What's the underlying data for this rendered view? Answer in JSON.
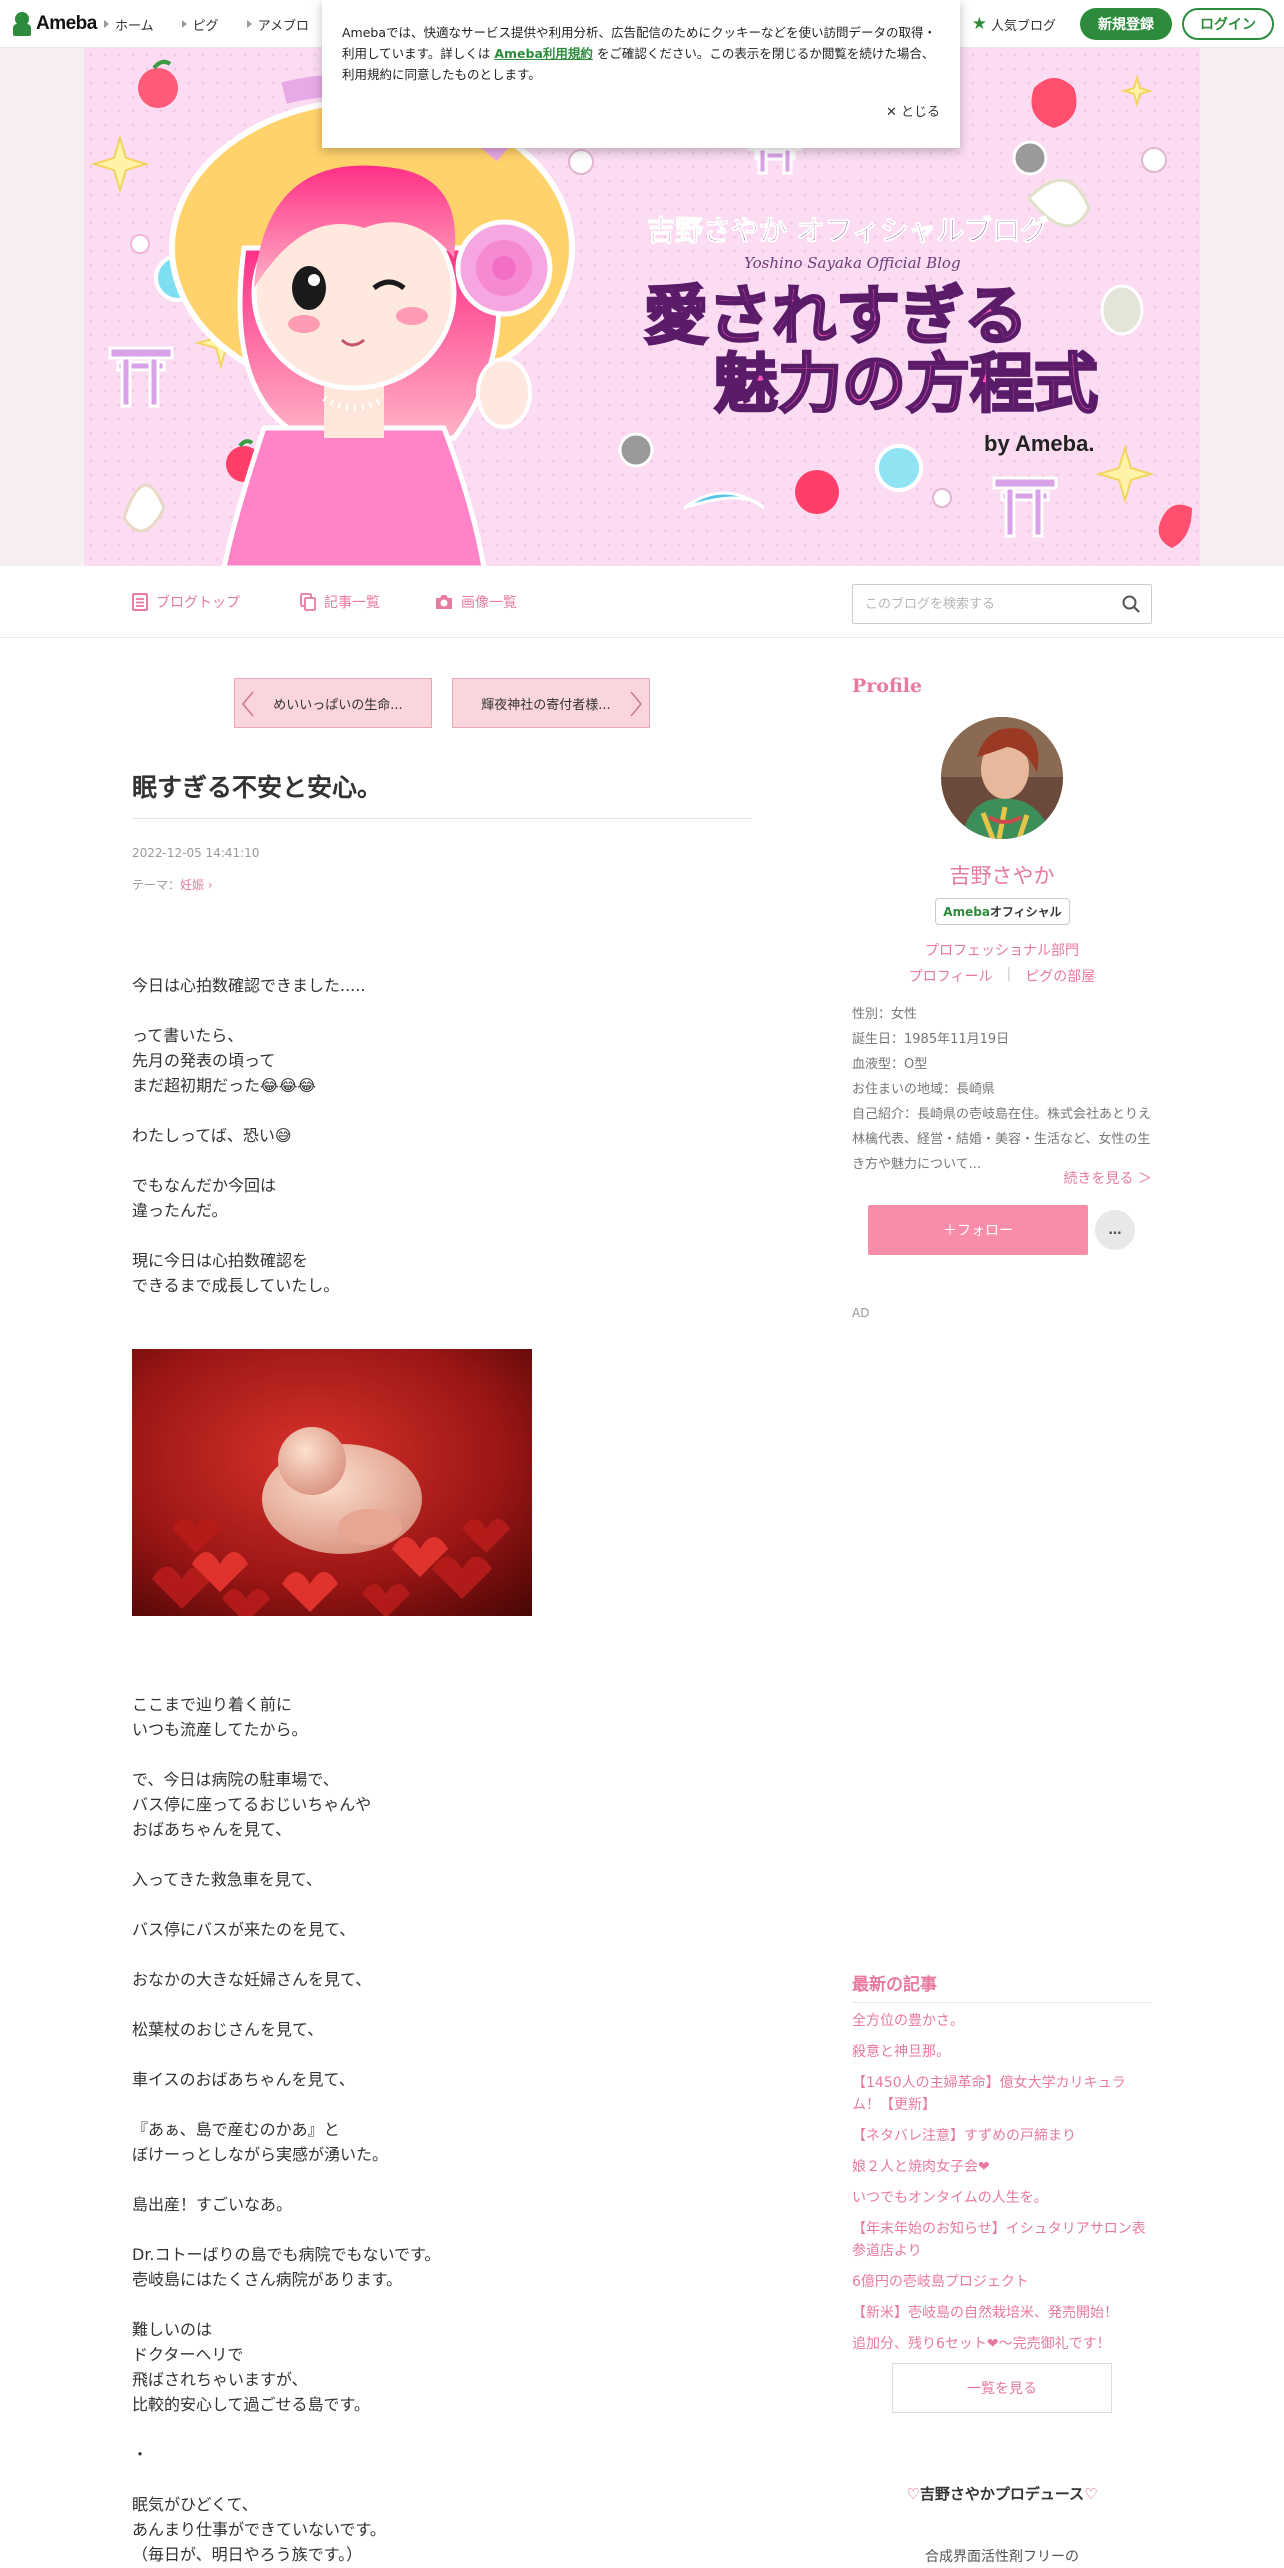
{
  "global_header": {
    "logo_text": "Ameba",
    "nav": [
      "ホーム",
      "ピグ",
      "アメブロ"
    ],
    "popular_blog": "人気ブログ",
    "register": "新規登録",
    "login": "ログイン"
  },
  "cookie_notice": {
    "text_before": "Amebaでは、快適なサービス提供や利用分析、広告配信のためにクッキーなどを使い訪問データの取得・利用しています。詳しくは ",
    "link_text": "Ameba利用規約",
    "text_after": " をご確認ください。この表示を閉じるか閲覧を続けた場合、利用規約に同意したものとします。",
    "close": "✕ とじる"
  },
  "banner": {
    "title_small": "吉野さやか オフィシャルブログ",
    "title_roman": "Yoshino Sayaka Official Blog",
    "title_main_1": "愛されすぎる",
    "title_main_2": "魅力の方程式",
    "by_label": "by Ameba."
  },
  "blog_nav": {
    "top": "ブログトップ",
    "list": "記事一覧",
    "images": "画像一覧",
    "search_placeholder": "このブログを検索する"
  },
  "article": {
    "prev": "めいいっぱいの生命...",
    "next": "輝夜神社の寄付者様...",
    "title": "眠すぎる不安と安心。",
    "date": "2022-12-05 14:41:10",
    "theme_label": "テーマ：",
    "theme_value": "妊娠",
    "paragraphs_a": [
      "今日は心拍数確認できました.....",
      "",
      "って書いたら、",
      "先月の発表の頃って",
      "まだ超初期だった😂😂😂",
      "",
      "わたしってば、恐い😅",
      "",
      "でもなんだか今回は",
      "違ったんだ。",
      "",
      "現に今日は心拍数確認を",
      "できるまで成長していたし。"
    ],
    "paragraphs_b": [
      "ここまで辿り着く前に",
      "いつも流産してたから。",
      "",
      "で、今日は病院の駐車場で、",
      "バス停に座ってるおじいちゃんや",
      "おばあちゃんを見て、",
      "",
      "入ってきた救急車を見て、",
      "",
      "バス停にバスが来たのを見て、",
      "",
      "おなかの大きな妊婦さんを見て、",
      "",
      "松葉杖のおじさんを見て、",
      "",
      "車イスのおばあちゃんを見て、",
      "",
      "『あぁ、島で産むのかあ』と",
      "ぼけーっとしながら実感が湧いた。",
      "",
      "島出産！すごいなあ。",
      "",
      "Dr.コトーばりの島でも病院でもないです。",
      "壱岐島にはたくさん病院があります。",
      "",
      "難しいのは",
      "ドクターヘリで",
      "飛ばされちゃいますが、",
      "比較的安心して過ごせる島です。",
      "",
      "・",
      "",
      "眠気がひどくて、",
      "あんまり仕事ができていないです。",
      "（毎日が、明日やろう族です。）"
    ]
  },
  "sidebar": {
    "profile_heading": "Profile",
    "name": "吉野さやか",
    "badge_accent": "Ameba",
    "badge_text": "オフィシャル",
    "category": "プロフェッショナル部門",
    "profile_link": "プロフィール",
    "pig_link": "ピグの部屋",
    "info": [
      "性別：女性",
      "誕生日：1985年11月19日",
      "血液型：O型",
      "お住まいの地域：長崎県",
      "自己紹介：長崎県の壱岐島在住。株式会社あとりえ林檎代表、経営・結婚・美容・生活など、女性の生き方や魅力について..."
    ],
    "more": "続きを見る ＞",
    "follow": "＋フォロー",
    "more_button": "…",
    "ad": "AD",
    "recent_heading": "最新の記事",
    "recent": [
      "全方位の豊かさ。",
      "殺意と神旦那。",
      "【1450人の主婦革命】億女大学カリキュラム！【更新】",
      "【ネタバレ注意】すずめの戸締まり",
      "娘２人と焼肉女子会❤",
      "いつでもオンタイムの人生を。",
      "【年末年始のお知らせ】イシュタリアサロン表参道店より",
      "6億円の壱岐島プロジェクト",
      "【新米】壱岐島の自然栽培米、発売開始！",
      "追加分、残り6セット❤～完売御礼です！"
    ],
    "list_button": "一覧を見る",
    "produce_title": "吉野さやかプロデュース",
    "produce_sub": "合成界面活性剤フリーの"
  },
  "colors": {
    "ameba_green": "#2d8c3c",
    "blog_pink": "#e87a9d",
    "follow_pink": "#f98ca8"
  }
}
